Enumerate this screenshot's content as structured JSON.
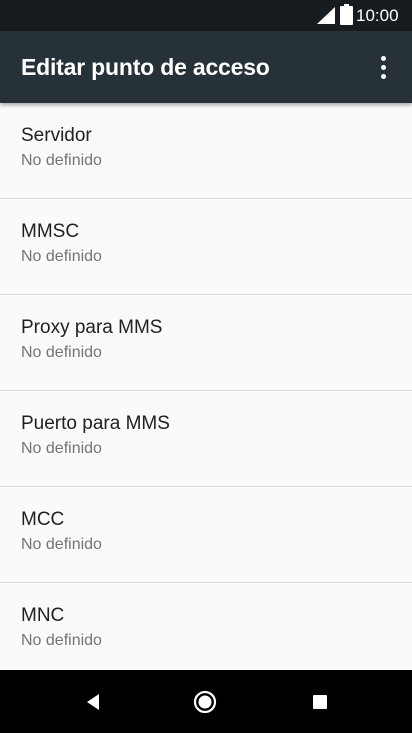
{
  "status_bar": {
    "time": "10:00",
    "icons": [
      "signal-icon",
      "battery-icon"
    ]
  },
  "app_bar": {
    "title": "Editar punto de acceso",
    "menu_icon": "more-vert-icon"
  },
  "settings": {
    "items": [
      {
        "label": "Servidor",
        "value": "No definido"
      },
      {
        "label": "MMSC",
        "value": "No definido"
      },
      {
        "label": "Proxy para MMS",
        "value": "No definido"
      },
      {
        "label": "Puerto para MMS",
        "value": "No definido"
      },
      {
        "label": "MCC",
        "value": "No definido"
      },
      {
        "label": "MNC",
        "value": "No definido"
      }
    ]
  },
  "nav_bar": {
    "buttons": [
      "back-icon",
      "home-icon",
      "recents-icon"
    ]
  },
  "colors": {
    "status_bar": "#161c1f",
    "app_bar": "#263238",
    "background": "#fafafa",
    "primary_text": "#212121",
    "secondary_text": "#757575",
    "nav_bar": "#000000"
  }
}
